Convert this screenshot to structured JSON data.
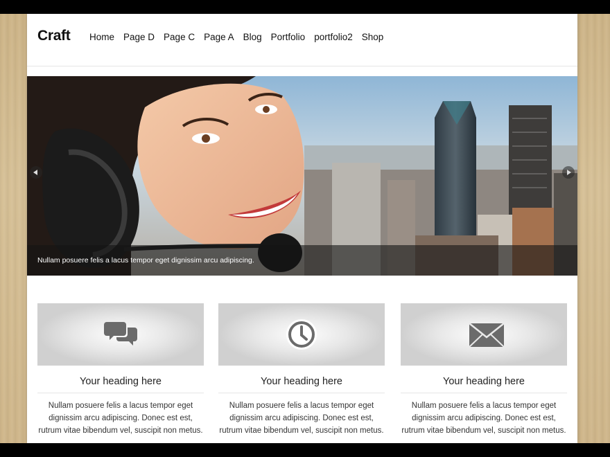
{
  "site": {
    "logo": "Craft"
  },
  "nav": {
    "items": [
      "Home",
      "Page D",
      "Page C",
      "Page A",
      "Blog",
      "Portfolio",
      "portfolio2",
      "Shop"
    ]
  },
  "slider": {
    "caption": "Nullam posuere felis a lacus tempor eget dignissim arcu adipiscing."
  },
  "features": [
    {
      "icon": "chat-bubbles-icon",
      "heading": "Your heading here",
      "text": "Nullam posuere felis a lacus tempor eget dignissim arcu adipiscing. Donec est est, rutrum vitae bibendum vel, suscipit non metus."
    },
    {
      "icon": "clock-icon",
      "heading": "Your heading here",
      "text": "Nullam posuere felis a lacus tempor eget dignissim arcu adipiscing. Donec est est, rutrum vitae bibendum vel, suscipit non metus."
    },
    {
      "icon": "envelope-icon",
      "heading": "Your heading here",
      "text": "Nullam posuere felis a lacus tempor eget dignissim arcu adipiscing. Donec est est, rutrum vitae bibendum vel, suscipit non metus."
    }
  ],
  "colors": {
    "wood_background": "#d2ba8e",
    "page_background": "#ffffff",
    "icon_gray": "#6b6b6b"
  }
}
